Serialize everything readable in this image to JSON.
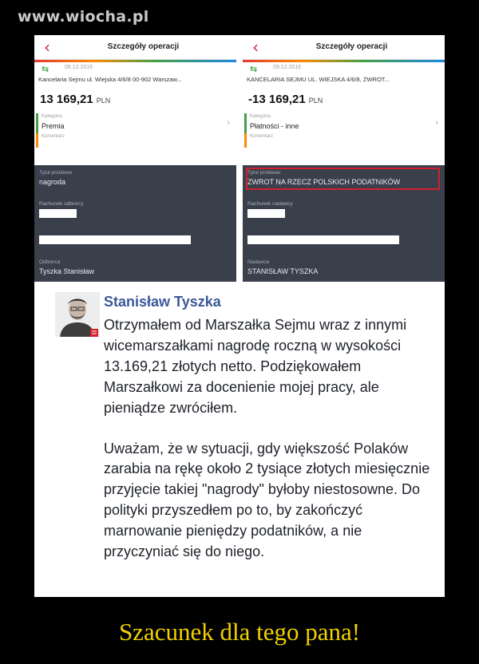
{
  "watermark": "www.wiocha.pl",
  "caption": "Szacunek dla tego pana!",
  "colors": {
    "accent_red": "#d0212c",
    "dark_panel": "#3a3f4c",
    "fb_blue": "#3b5998",
    "caption_yellow": "#f0d000"
  },
  "left": {
    "title": "Szczegóły operacji",
    "date": "06.12.2016",
    "description": "Kancelaria Sejmu ul. Wiejska 4/6/8 00-902 Warszaw...",
    "amount": "13 169,21",
    "currency": "PLN",
    "category_label": "Kategoria",
    "category_value": "Premia",
    "comment_label": "Komentarz",
    "title_label": "Tytuł przelewu",
    "title_value": "nagroda",
    "account_label": "Rachunek odbiorcy",
    "party_label": "Odbiorca",
    "party_value": "Tyszka Stanisław"
  },
  "right": {
    "title": "Szczegóły operacji",
    "date": "09.12.2016",
    "description": "KANCELARIA SEJMU UL. WIEJSKA 4/6/8, ZWROT...",
    "amount": "-13 169,21",
    "currency": "PLN",
    "category_label": "Kategoria",
    "category_value": "Płatności - inne",
    "comment_label": "Komentarz",
    "title_label": "Tytuł przelewu",
    "title_value": "ZWROT NA RZECZ POLSKICH PODATNIKÓW",
    "account_label": "Rachunek nadawcy",
    "party_label": "Nadawca",
    "party_value": "STANISŁAW TYSZKA"
  },
  "post": {
    "author": "Stanisław Tyszka",
    "paragraph1": "Otrzymałem od Marszałka Sejmu wraz z innymi wicemarszałkami nagrodę roczną w wysokości 13.169,21 złotych netto. Podziękowałem Marszałkowi za docenienie mojej pracy, ale pieniądze zwróciłem.",
    "paragraph2": "Uważam, że w sytuacji, gdy większość Polaków zarabia na rękę około 2 tysiące złotych miesięcznie przyjęcie takiej \"nagrody\" byłoby niestosowne. Do polityki przyszedłem po to, by zakończyć marnowanie pieniędzy podatników, a nie przyczyniać się do niego."
  }
}
